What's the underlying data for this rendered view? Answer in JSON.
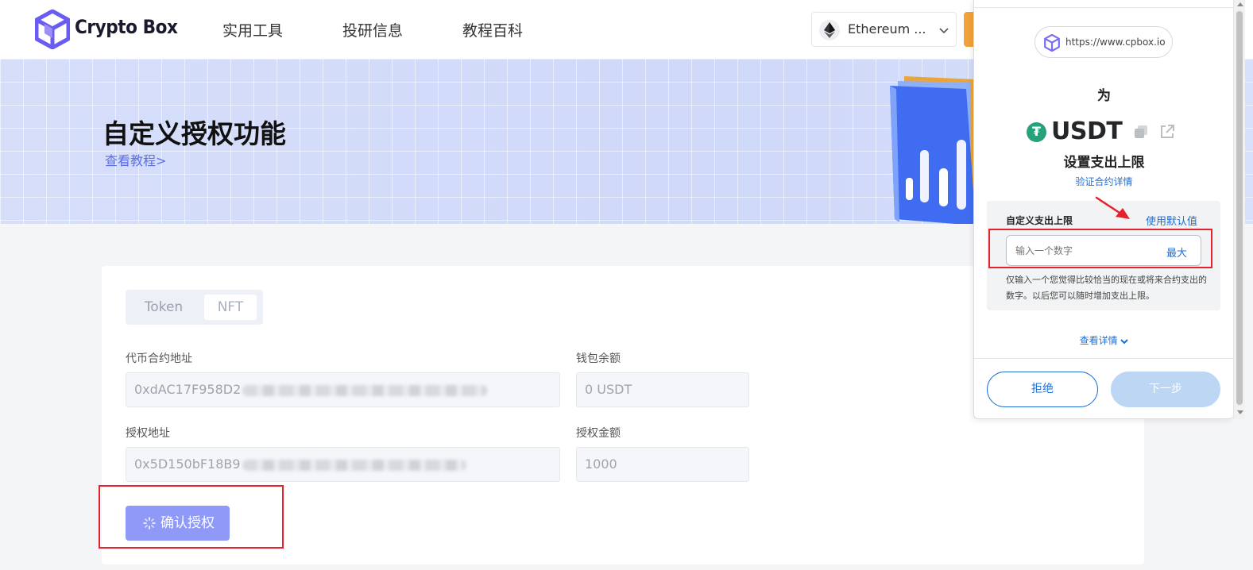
{
  "header": {
    "brand": "Crypto Box",
    "nav": [
      "实用工具",
      "投研信息",
      "教程百科"
    ],
    "network": "Ethereum ...",
    "network_icon": "ethereum-icon"
  },
  "banner": {
    "title": "自定义授权功能",
    "tutorial_link": "查看教程>"
  },
  "form": {
    "tabs": [
      "Token",
      "NFT"
    ],
    "contract_label": "代币合约地址",
    "contract_value": "0xdAC17F958D2",
    "balance_label": "钱包余额",
    "balance_value": "0 USDT",
    "spender_label": "授权地址",
    "spender_value": "0x5D150bF18B9",
    "amount_label": "授权金额",
    "amount_value": "1000",
    "confirm_label": "确认授权"
  },
  "popup": {
    "origin": "https://www.cpbox.io",
    "for_label": "为",
    "token": "USDT",
    "token_icon": "tether-icon",
    "subtitle": "设置支出上限",
    "verify_link": "验证合约详情",
    "limit_label": "自定义支出上限",
    "use_default": "使用默认值",
    "input_placeholder": "输入一个数字",
    "max_label": "最大",
    "help_text": "仅输入一个您觉得比较恰当的现在或将来合约支出的数字。以后您可以随时增加支出上限。",
    "view_details": "查看详情",
    "reject_label": "拒绝",
    "next_label": "下一步"
  },
  "colors": {
    "accent": "#8f99f8",
    "link": "#5b6ee1",
    "wallet_blue": "#1f6fd6",
    "highlight_red": "#e5212c",
    "tether_green": "#26a17b"
  }
}
